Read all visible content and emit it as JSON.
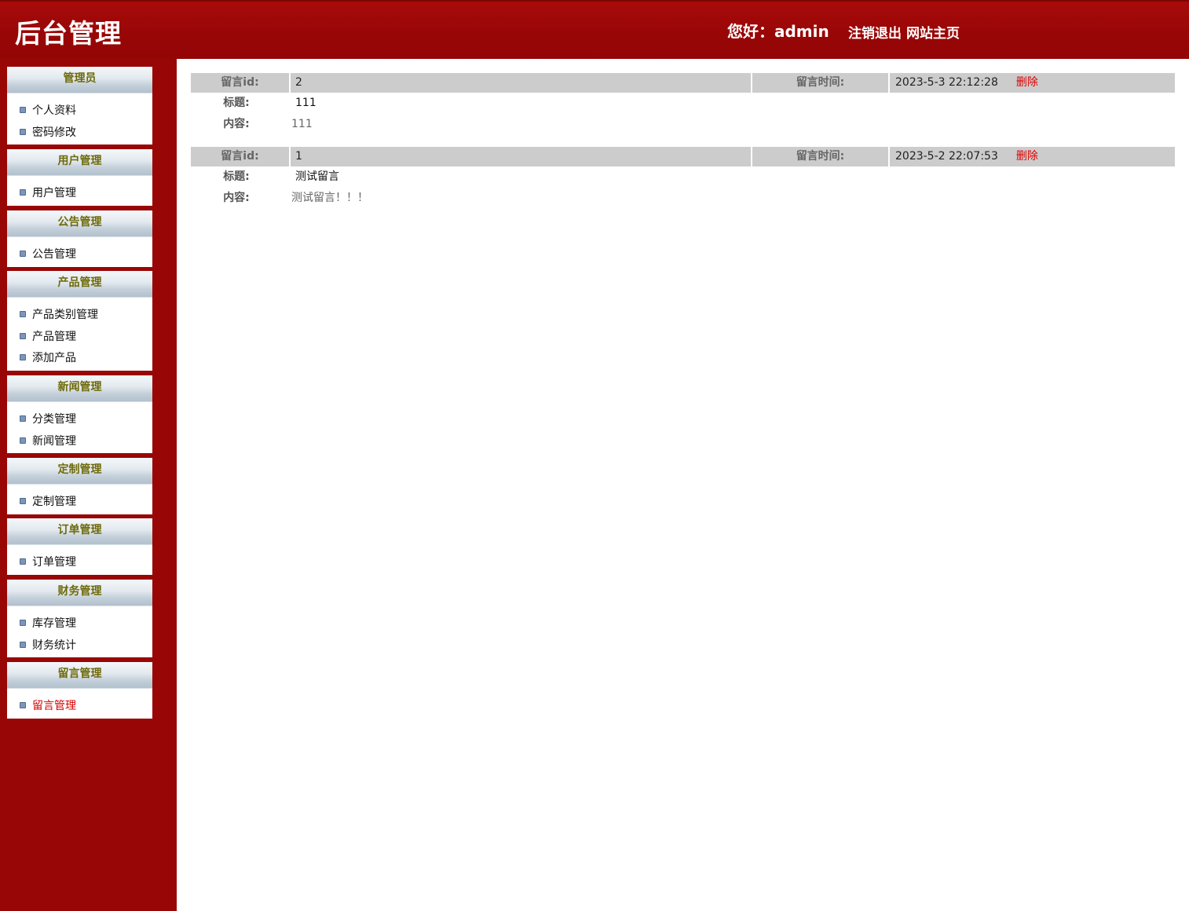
{
  "header": {
    "title": "后台管理",
    "greeting": "您好：admin",
    "logout": "注销退出",
    "home": "网站主页"
  },
  "sidebar": [
    {
      "title": "管理员",
      "items": [
        "个人资料",
        "密码修改"
      ]
    },
    {
      "title": "用户管理",
      "items": [
        "用户管理"
      ]
    },
    {
      "title": "公告管理",
      "items": [
        "公告管理"
      ]
    },
    {
      "title": "产品管理",
      "items": [
        "产品类别管理",
        "产品管理",
        "添加产品"
      ]
    },
    {
      "title": "新闻管理",
      "items": [
        "分类管理",
        "新闻管理"
      ]
    },
    {
      "title": "定制管理",
      "items": [
        "定制管理"
      ]
    },
    {
      "title": "订单管理",
      "items": [
        "订单管理"
      ]
    },
    {
      "title": "财务管理",
      "items": [
        "库存管理",
        "财务统计"
      ]
    },
    {
      "title": "留言管理",
      "items": [
        "留言管理"
      ],
      "active": 0
    }
  ],
  "labels": {
    "id": "留言id:",
    "time": "留言时间:",
    "title": "标题:",
    "content": "内容:",
    "delete": "删除"
  },
  "messages": [
    {
      "id": "2",
      "time": "2023-5-3 22:12:28",
      "title": "111",
      "content": "111"
    },
    {
      "id": "1",
      "time": "2023-5-2 22:07:53",
      "title": "测试留言",
      "content": "测试留言！！！"
    }
  ]
}
